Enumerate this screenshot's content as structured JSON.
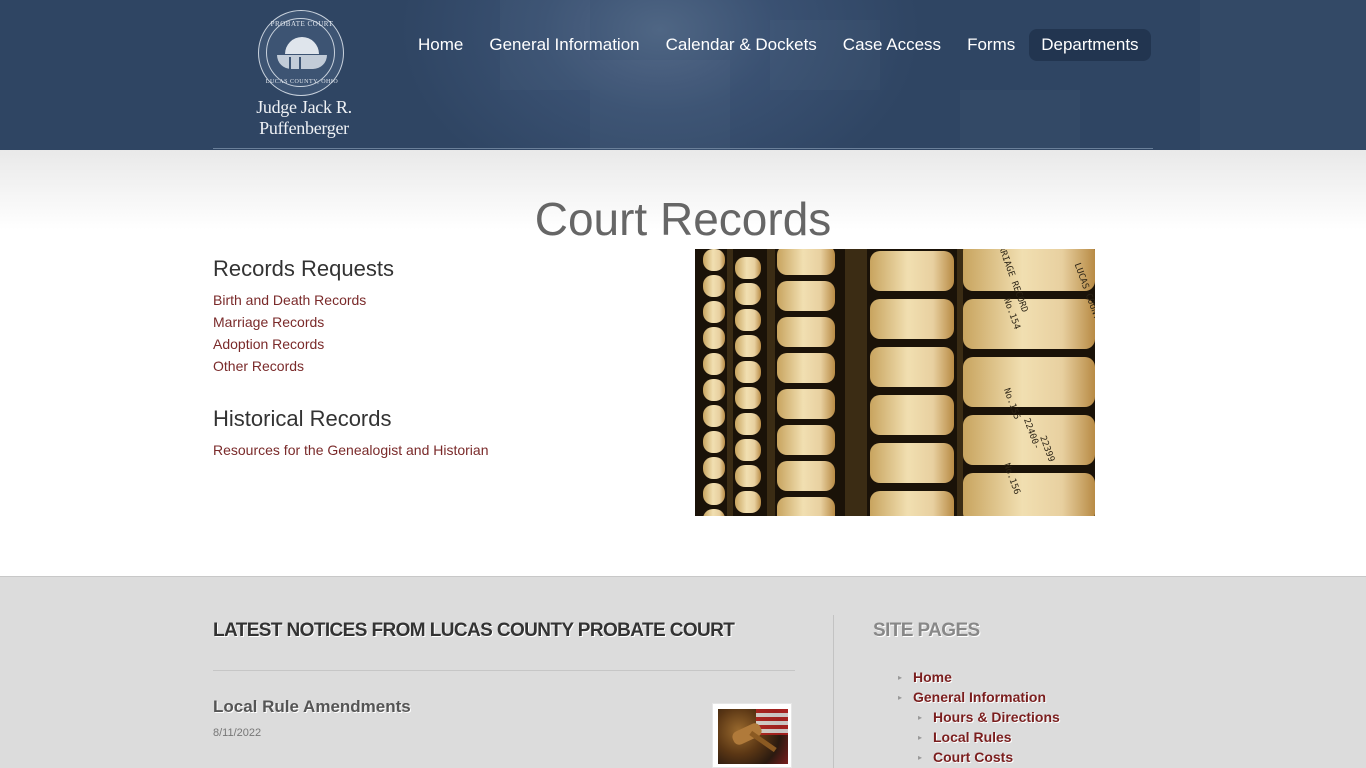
{
  "header": {
    "seal_top": "PROBATE COURT",
    "seal_bottom": "LUCAS COUNTY, OHIO",
    "judge": "Judge Jack R. Puffenberger"
  },
  "nav": {
    "items": [
      {
        "label": "Home"
      },
      {
        "label": "General Information"
      },
      {
        "label": "Calendar & Dockets"
      },
      {
        "label": "Case Access"
      },
      {
        "label": "Forms"
      },
      {
        "label": "Departments"
      }
    ],
    "active": "Departments"
  },
  "main": {
    "title": "Court Records",
    "records_requests": {
      "heading": "Records Requests",
      "links": [
        "Birth and Death Records",
        "Marriage Records",
        "Adoption Records",
        "Other Records"
      ]
    },
    "historical_records": {
      "heading": "Historical Records",
      "links": [
        "Resources for the Genealogist and Historian"
      ]
    },
    "photo_labels": [
      "No.154",
      "No.155",
      "No.156",
      "LUCAS COUNTY",
      "MARRIAGE RECORD",
      "22400-",
      "22399"
    ]
  },
  "footer": {
    "notices_heading": "LATEST NOTICES FROM LUCAS COUNTY PROBATE COURT",
    "notice": {
      "title": "Local Rule Amendments",
      "date": "8/11/2022"
    },
    "site_pages_heading": "SITE PAGES",
    "site_pages": [
      {
        "label": "Home",
        "level": 0
      },
      {
        "label": "General Information",
        "level": 0
      },
      {
        "label": "Hours & Directions",
        "level": 1
      },
      {
        "label": "Local Rules",
        "level": 1
      },
      {
        "label": "Court Costs",
        "level": 1
      }
    ]
  },
  "colors": {
    "header_bg": "#2f4563",
    "link": "#7a2a2a",
    "site_page_link": "#7a1e1e",
    "footer_bg": "#dcdcdc"
  }
}
